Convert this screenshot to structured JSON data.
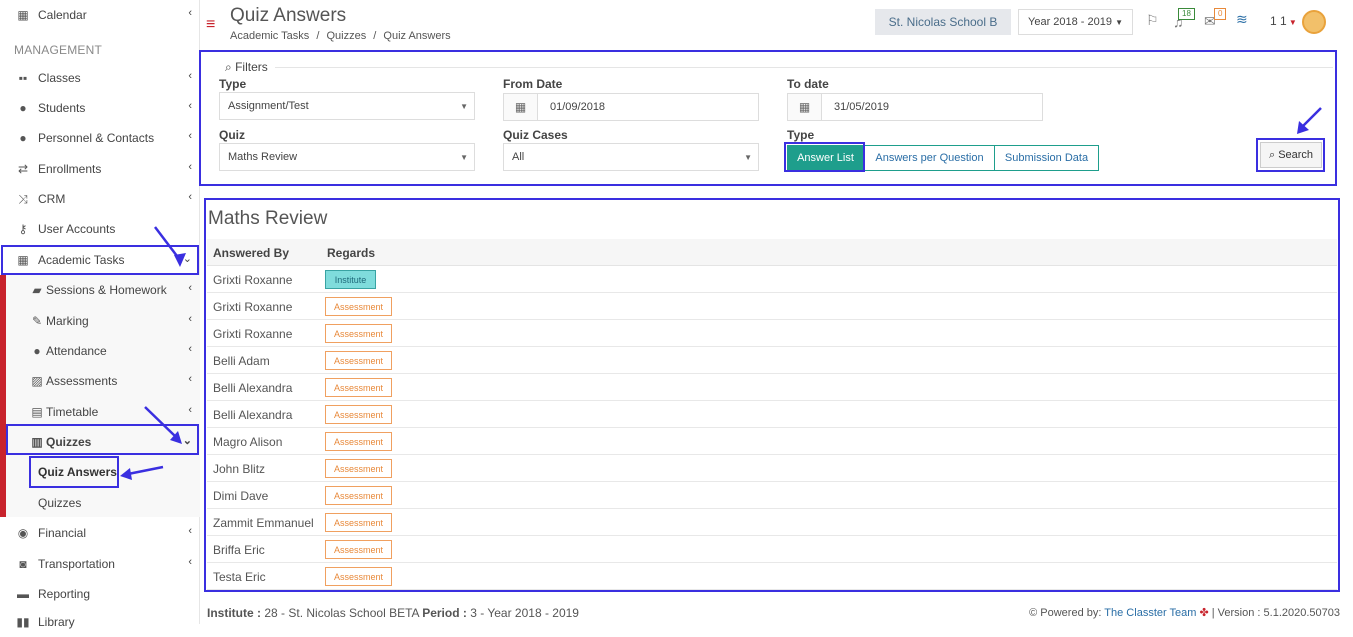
{
  "sidebar": {
    "heading": "MANAGEMENT",
    "calendar": "Calendar",
    "classes": "Classes",
    "students": "Students",
    "personnel": "Personnel & Contacts",
    "enrollments": "Enrollments",
    "crm": "CRM",
    "user_accounts": "User Accounts",
    "academic_tasks": "Academic Tasks",
    "sessions": "Sessions & Homework",
    "marking": "Marking",
    "attendance": "Attendance",
    "assessments": "Assessments",
    "timetable": "Timetable",
    "quizzes_group": "Quizzes",
    "quiz_answers": "Quiz Answers",
    "quizzes": "Quizzes",
    "financial": "Financial",
    "transportation": "Transportation",
    "reporting": "Reporting",
    "library": "Library"
  },
  "header": {
    "title": "Quiz Answers",
    "breadcrumb": [
      "Academic Tasks",
      "/",
      "Quizzes",
      "/",
      "Quiz Answers"
    ],
    "school": "St. Nicolas School B",
    "year": "Year 2018 - 2019",
    "notif_count": "18",
    "mail_count": "0",
    "user_short": "1 1"
  },
  "filters": {
    "legend": "Filters",
    "type_label": "Type",
    "type_value": "Assignment/Test",
    "from_label": "From Date",
    "from_value": "01/09/2018",
    "to_label": "To date",
    "to_value": "31/05/2019",
    "quiz_label": "Quiz",
    "quiz_value": "Maths Review",
    "cases_label": "Quiz Cases",
    "cases_value": "All",
    "type2_label": "Type",
    "btn_answer_list": "Answer List",
    "btn_per_question": "Answers per Question",
    "btn_submission": "Submission Data",
    "search": "Search"
  },
  "results": {
    "title": "Maths Review",
    "col_answered_by": "Answered By",
    "col_regards": "Regards",
    "rows": [
      {
        "name": "Grixti Roxanne",
        "regards": "Institute"
      },
      {
        "name": "Grixti Roxanne",
        "regards": "Assessment"
      },
      {
        "name": "Grixti Roxanne",
        "regards": "Assessment"
      },
      {
        "name": "Belli Adam",
        "regards": "Assessment"
      },
      {
        "name": "Belli Alexandra",
        "regards": "Assessment"
      },
      {
        "name": "Belli Alexandra",
        "regards": "Assessment"
      },
      {
        "name": "Magro Alison",
        "regards": "Assessment"
      },
      {
        "name": "John Blitz",
        "regards": "Assessment"
      },
      {
        "name": "Dimi Dave",
        "regards": "Assessment"
      },
      {
        "name": "Zammit Emmanuel",
        "regards": "Assessment"
      },
      {
        "name": "Briffa Eric",
        "regards": "Assessment"
      },
      {
        "name": "Testa Eric",
        "regards": "Assessment"
      }
    ]
  },
  "footer": {
    "institute_label": "Institute :",
    "institute_value": "28 - St. Nicolas School BETA",
    "period_label": "Period :",
    "period_value": "3 - Year 2018 - 2019",
    "powered": "Powered by:",
    "team": "The Classter Team",
    "version": "| Version : 5.1.2020.50703"
  },
  "colors": {
    "accent": "#1e9e8c",
    "highlight": "#3a2fe0",
    "brand_red": "#c8232c"
  }
}
